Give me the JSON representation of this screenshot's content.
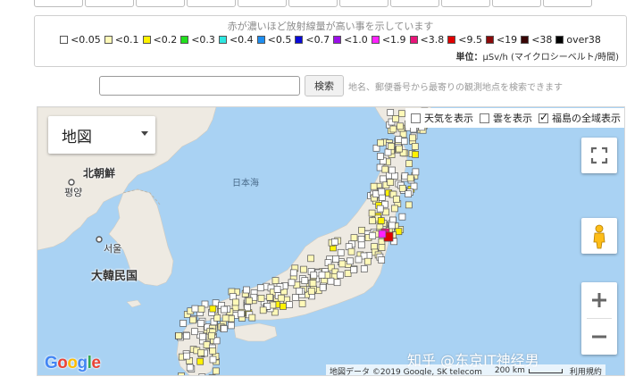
{
  "legend": {
    "title": "赤が濃いほど放射線量が高い事を示しています",
    "items": [
      {
        "label": "<0.05",
        "color": "#ffffff"
      },
      {
        "label": "<0.1",
        "color": "#fff9b8"
      },
      {
        "label": "<0.2",
        "color": "#fff200"
      },
      {
        "label": "<0.3",
        "color": "#22e01e"
      },
      {
        "label": "<0.4",
        "color": "#2ee6e0"
      },
      {
        "label": "<0.5",
        "color": "#1f8ef0"
      },
      {
        "label": "<0.7",
        "color": "#0a0ad8"
      },
      {
        "label": "<1.0",
        "color": "#9b10e8"
      },
      {
        "label": "<1.9",
        "color": "#ff22ff"
      },
      {
        "label": "<3.8",
        "color": "#e8157a"
      },
      {
        "label": "<9.5",
        "color": "#e00000"
      },
      {
        "label": "<19",
        "color": "#8a0a0a"
      },
      {
        "label": "<38",
        "color": "#3a0606"
      },
      {
        "label": "over38",
        "color": "#000000"
      }
    ],
    "unit_label": "単位：",
    "unit_value": "μSv/h (マイクロシーベルト/時間)"
  },
  "search": {
    "input_value": "",
    "button_label": "検索",
    "hint": "地名、郵便番号から最寄りの観測地点を検索できます"
  },
  "map": {
    "type_label": "地図",
    "layers": [
      {
        "label": "天気を表示",
        "checked": false
      },
      {
        "label": "雲を表示",
        "checked": false
      },
      {
        "label": "福島の全域表示",
        "checked": true
      }
    ],
    "labels": {
      "sea": "日本海",
      "north_korea": "北朝鮮",
      "pyongyang": "평양",
      "seoul": "서울",
      "south_korea": "大韓民国"
    },
    "google_letters": [
      {
        "ch": "G",
        "color": "#4285f4"
      },
      {
        "ch": "o",
        "color": "#ea4335"
      },
      {
        "ch": "o",
        "color": "#fbbc05"
      },
      {
        "ch": "g",
        "color": "#4285f4"
      },
      {
        "ch": "l",
        "color": "#34a853"
      },
      {
        "ch": "e",
        "color": "#ea4335"
      }
    ],
    "attribution": "地図データ ©2019 Google, SK telecom",
    "scale_label": "200 km",
    "terms": "利用規約",
    "watermark": "知乎 @东京IT神经男",
    "colors": {
      "sea": "#a9d2f3",
      "land": "#eeeae2",
      "marker_border": "#555555"
    }
  }
}
